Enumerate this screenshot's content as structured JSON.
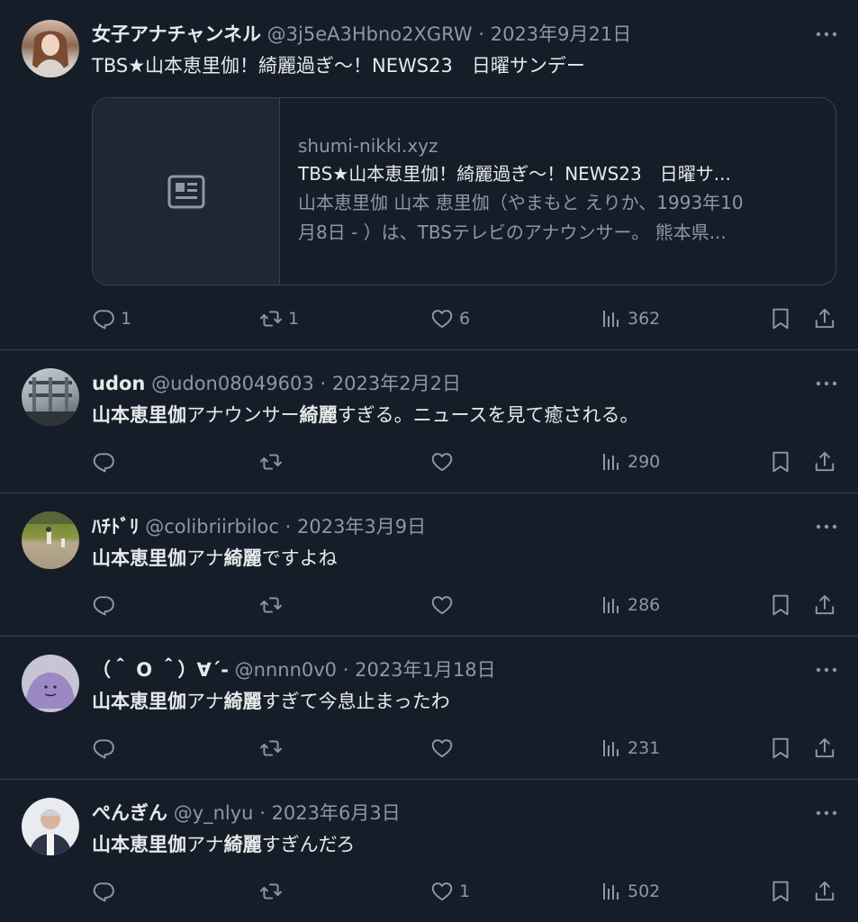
{
  "tweets": [
    {
      "name": "女子アナチャンネル",
      "handle": "@3j5eA3Hbno2XGRW",
      "sep": "·",
      "date": "2023年9月21日",
      "text": "TBS★山本恵里伽！綺麗過ぎ〜！NEWS23　日曜サンデー",
      "card": {
        "domain": "shumi-nikki.xyz",
        "title": "TBS★山本恵里伽！綺麗過ぎ〜！NEWS23　日曜サ...",
        "desc_line1": "山本恵里伽 山本 恵里伽（やまもと えりか、1993年10",
        "desc_line2": "月8日 - ）は、TBSテレビのアナウンサー。 熊本県..."
      },
      "replies": "1",
      "retweets": "1",
      "likes": "6",
      "views": "362"
    },
    {
      "name": "udon",
      "handle": "@udon08049603",
      "sep": "·",
      "date": "2023年2月2日",
      "text_bold": "山本恵里伽",
      "text_rest1": "アナウンサー",
      "text_bold2": "綺麗",
      "text_rest2": "すぎる。ニュースを見て癒される。",
      "replies": "",
      "retweets": "",
      "likes": "",
      "views": "290"
    },
    {
      "name": "ﾊﾁﾄﾞﾘ",
      "handle": "@colibriirbiloc",
      "sep": "·",
      "date": "2023年3月9日",
      "text_bold": "山本恵里伽",
      "text_rest1": "アナ",
      "text_bold2": "綺麗",
      "text_rest2": "ですよね",
      "replies": "",
      "retweets": "",
      "likes": "",
      "views": "286"
    },
    {
      "name": "（＾ O ＾）∀´-",
      "handle": "@nnnn0v0",
      "sep": "·",
      "date": "2023年1月18日",
      "text_bold": "山本恵里伽",
      "text_rest1": "アナ",
      "text_bold2": "綺麗",
      "text_rest2": "すぎて今息止まったわ",
      "replies": "",
      "retweets": "",
      "likes": "",
      "views": "231"
    },
    {
      "name": "ぺんぎん",
      "handle": "@y_nlyu",
      "sep": "·",
      "date": "2023年6月3日",
      "text_bold": "山本恵里伽",
      "text_rest1": "アナ",
      "text_bold2": "綺麗",
      "text_rest2": "すぎんだろ",
      "replies": "",
      "retweets": "",
      "likes": "1",
      "views": "502"
    }
  ],
  "colors": {
    "background": "#151d28",
    "text": "#e7e9ea",
    "muted": "#8b98a5",
    "border": "#38444d"
  }
}
